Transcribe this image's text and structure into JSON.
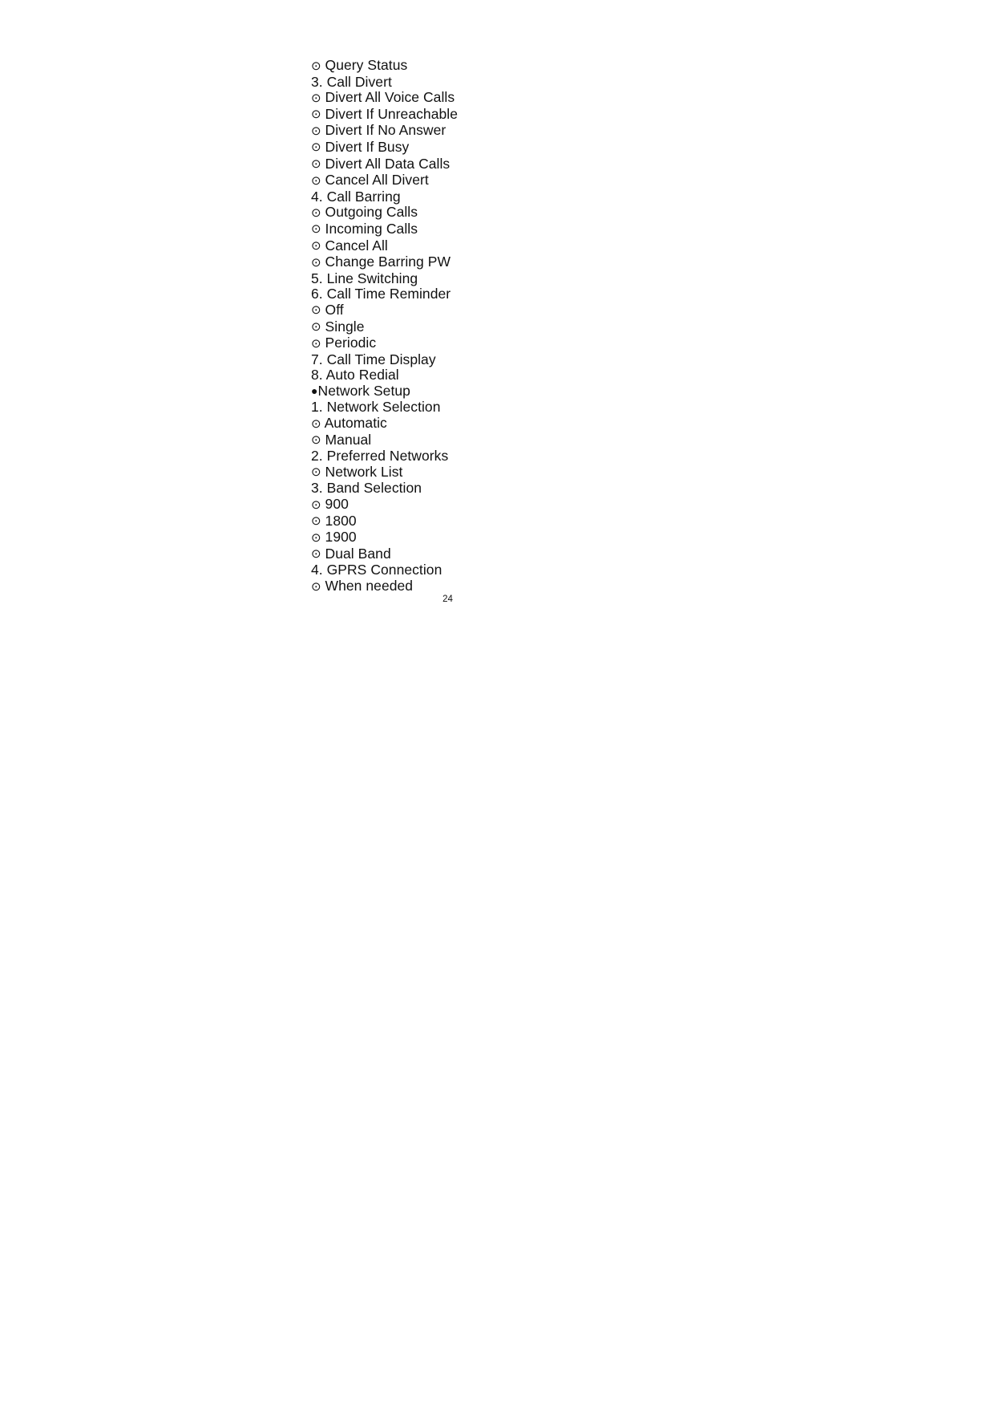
{
  "document": {
    "page_number": "24",
    "bullet_glyphs": {
      "option": "⊙",
      "section": "●"
    },
    "lines": [
      {
        "type": "option",
        "label": "Query Status"
      },
      {
        "type": "numbered",
        "label": "3. Call Divert"
      },
      {
        "type": "option",
        "label": "Divert All Voice Calls"
      },
      {
        "type": "option",
        "label": "Divert If Unreachable"
      },
      {
        "type": "option",
        "label": "Divert If No Answer"
      },
      {
        "type": "option",
        "label": "Divert If Busy"
      },
      {
        "type": "option",
        "label": "Divert All Data Calls"
      },
      {
        "type": "option",
        "label": "Cancel All Divert"
      },
      {
        "type": "numbered",
        "label": "4. Call Barring"
      },
      {
        "type": "option",
        "label": "Outgoing Calls"
      },
      {
        "type": "option",
        "label": "Incoming Calls"
      },
      {
        "type": "option",
        "label": "Cancel All"
      },
      {
        "type": "option",
        "label": "Change Barring PW"
      },
      {
        "type": "numbered",
        "label": "5. Line Switching"
      },
      {
        "type": "numbered",
        "label": "6. Call Time Reminder"
      },
      {
        "type": "option",
        "label": "Off"
      },
      {
        "type": "option",
        "label": "Single"
      },
      {
        "type": "option",
        "label": "Periodic"
      },
      {
        "type": "numbered",
        "label": "7. Call Time Display"
      },
      {
        "type": "numbered",
        "label": "8. Auto Redial"
      },
      {
        "type": "section",
        "label": "Network Setup"
      },
      {
        "type": "numbered",
        "label": "1. Network Selection"
      },
      {
        "type": "option",
        "label": "Automatic"
      },
      {
        "type": "option",
        "label": "Manual"
      },
      {
        "type": "numbered",
        "label": "2. Preferred Networks"
      },
      {
        "type": "option",
        "label": "Network List"
      },
      {
        "type": "numbered",
        "label": "3. Band Selection"
      },
      {
        "type": "option",
        "label": "900"
      },
      {
        "type": "option",
        "label": "1800"
      },
      {
        "type": "option",
        "label": "1900"
      },
      {
        "type": "option",
        "label": "Dual Band"
      },
      {
        "type": "numbered",
        "label": "4. GPRS Connection"
      },
      {
        "type": "option",
        "label": "When needed"
      }
    ]
  }
}
